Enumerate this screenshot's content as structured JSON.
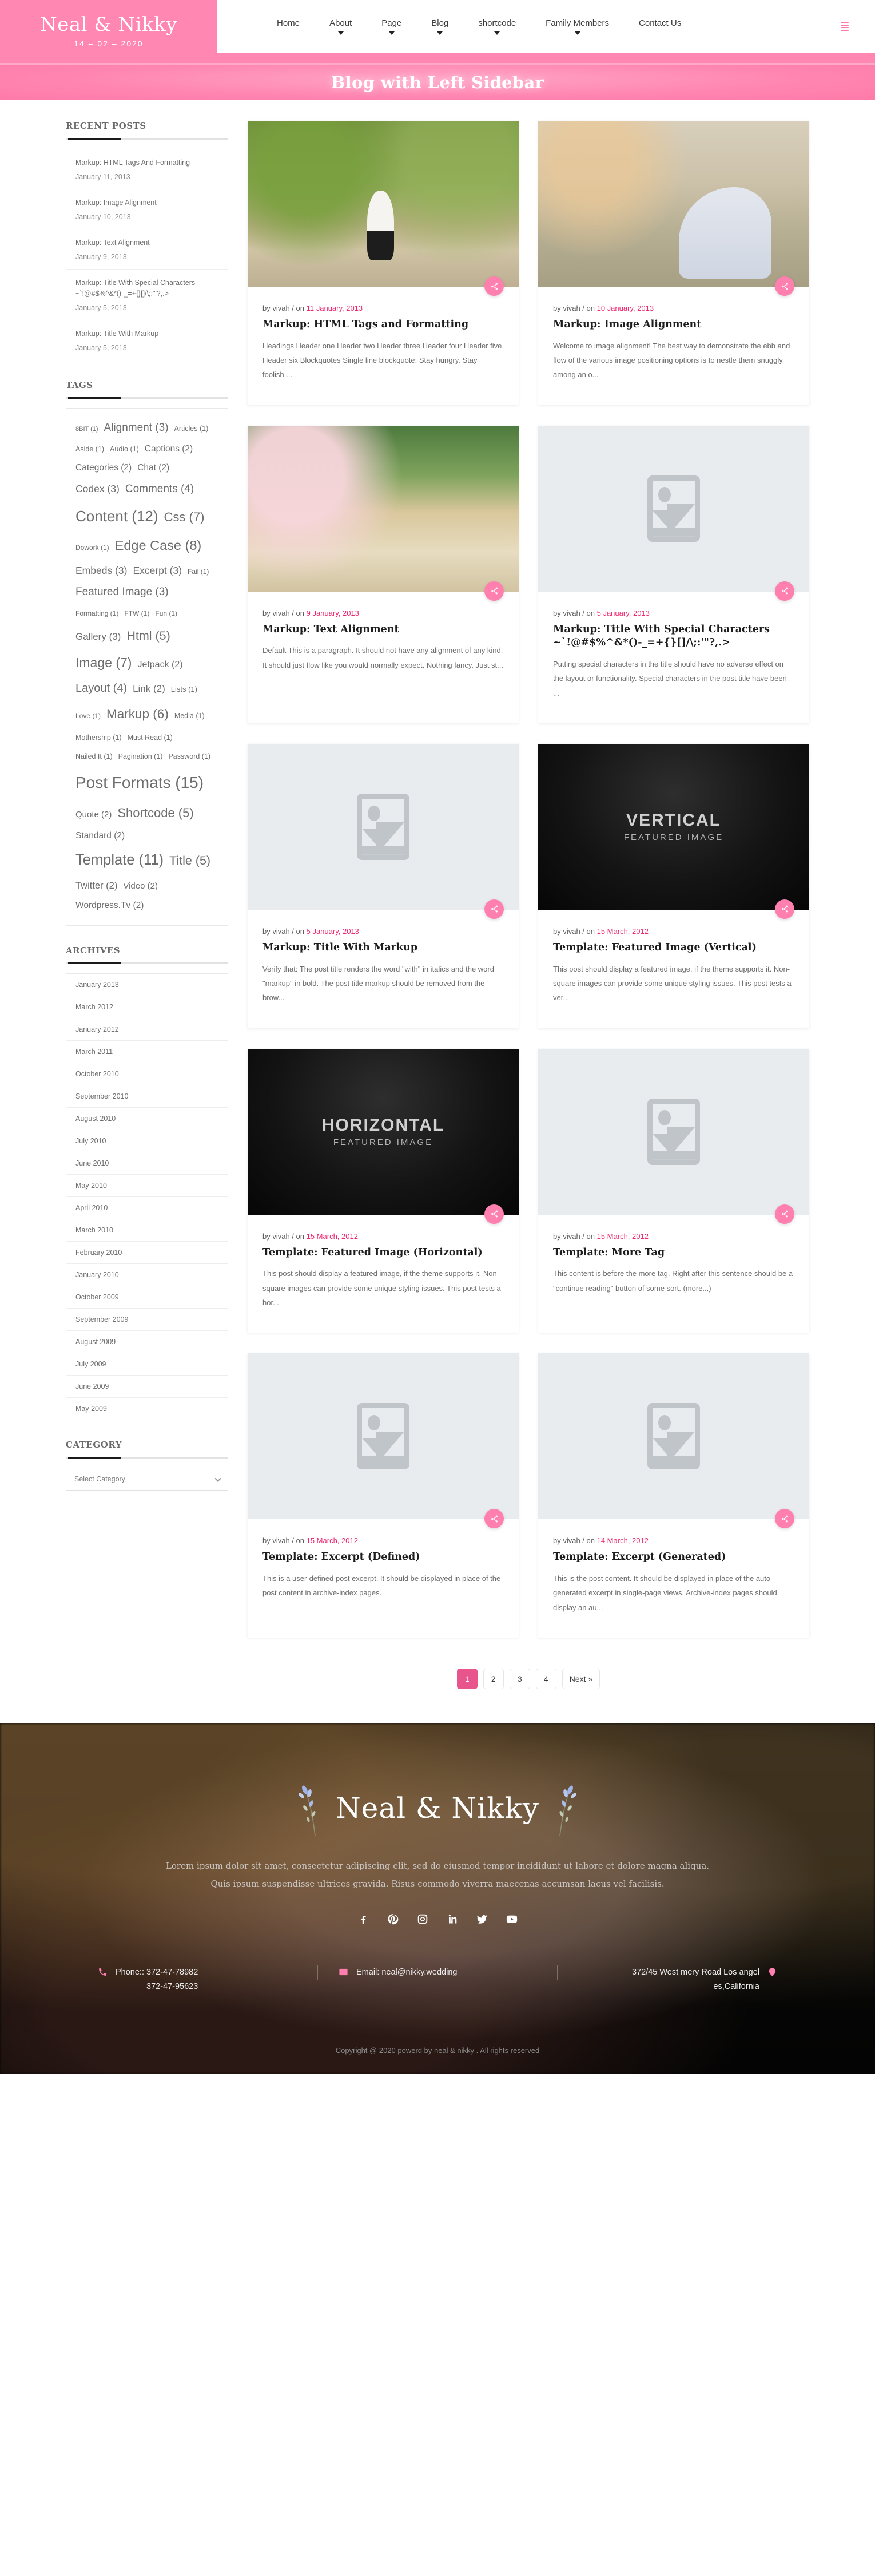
{
  "header": {
    "brand_name": "Neal & Nikky",
    "brand_date": "14 – 02 – 2020",
    "nav": [
      {
        "label": "Home",
        "has_dropdown": false
      },
      {
        "label": "About",
        "has_dropdown": true
      },
      {
        "label": "Page",
        "has_dropdown": true
      },
      {
        "label": "Blog",
        "has_dropdown": true
      },
      {
        "label": "shortcode",
        "has_dropdown": true
      },
      {
        "label": "Family Members",
        "has_dropdown": true
      },
      {
        "label": "Contact Us",
        "has_dropdown": false
      }
    ],
    "menu_icon": "hamburger-icon"
  },
  "banner": {
    "title": "Blog with Left Sidebar"
  },
  "sidebar": {
    "recent_posts": {
      "title": "RECENT POSTS",
      "items": [
        {
          "title": "Markup: HTML Tags And Formatting",
          "date": "January 11, 2013"
        },
        {
          "title": "Markup: Image Alignment",
          "date": "January 10, 2013"
        },
        {
          "title": "Markup: Text Alignment",
          "date": "January 9, 2013"
        },
        {
          "title": "Markup: Title With Special Characters ~`!@#$%^&*()-_=+{}[]/\\;:'\"?,.>",
          "date": "January 5, 2013"
        },
        {
          "title": "Markup: Title With Markup",
          "date": "January 5, 2013"
        }
      ]
    },
    "tags": {
      "title": "TAGS",
      "items": [
        {
          "label": "8BIT (1)",
          "size": 11
        },
        {
          "label": "Alignment (3)",
          "size": 19
        },
        {
          "label": "Articles (1)",
          "size": 12.5
        },
        {
          "label": "Aside (1)",
          "size": 12.5
        },
        {
          "label": "Audio (1)",
          "size": 12.5
        },
        {
          "label": "Captions (2)",
          "size": 15.5
        },
        {
          "label": "Categories (2)",
          "size": 15.5
        },
        {
          "label": "Chat (2)",
          "size": 15.5
        },
        {
          "label": "Codex (3)",
          "size": 17.5
        },
        {
          "label": "Comments (4)",
          "size": 19
        },
        {
          "label": "Content (12)",
          "size": 26
        },
        {
          "label": "Css (7)",
          "size": 22
        },
        {
          "label": "Dowork (1)",
          "size": 12
        },
        {
          "label": "Edge Case (8)",
          "size": 23.5
        },
        {
          "label": "Embeds (3)",
          "size": 17.5
        },
        {
          "label": "Excerpt (3)",
          "size": 17.5
        },
        {
          "label": "Fail (1)",
          "size": 12
        },
        {
          "label": "Featured Image (3)",
          "size": 19
        },
        {
          "label": "Formatting (1)",
          "size": 12
        },
        {
          "label": "FTW (1)",
          "size": 12
        },
        {
          "label": "Fun (1)",
          "size": 12
        },
        {
          "label": "Gallery (3)",
          "size": 17
        },
        {
          "label": "Html (5)",
          "size": 21.5
        },
        {
          "label": "Image (7)",
          "size": 23
        },
        {
          "label": "Jetpack (2)",
          "size": 16
        },
        {
          "label": "Layout (4)",
          "size": 20
        },
        {
          "label": "Link (2)",
          "size": 17
        },
        {
          "label": "Lists (1)",
          "size": 13
        },
        {
          "label": "Love (1)",
          "size": 12
        },
        {
          "label": "Markup (6)",
          "size": 22.5
        },
        {
          "label": "Media (1)",
          "size": 12.5
        },
        {
          "label": "Mothership (1)",
          "size": 12.5
        },
        {
          "label": "Must Read (1)",
          "size": 12.5
        },
        {
          "label": "Nailed It (1)",
          "size": 12.5
        },
        {
          "label": "Pagination (1)",
          "size": 12.5
        },
        {
          "label": "Password (1)",
          "size": 12.5
        },
        {
          "label": "Post Formats (15)",
          "size": 28
        },
        {
          "label": "Quote (2)",
          "size": 15
        },
        {
          "label": "Shortcode (5)",
          "size": 22
        },
        {
          "label": "Standard (2)",
          "size": 15.5
        },
        {
          "label": "Template (11)",
          "size": 25.5
        },
        {
          "label": "Title (5)",
          "size": 21.5
        },
        {
          "label": "Twitter (2)",
          "size": 16.5
        },
        {
          "label": "Video (2)",
          "size": 15
        },
        {
          "label": "Wordpress.Tv (2)",
          "size": 15.5
        }
      ]
    },
    "archives": {
      "title": "ARCHIVES",
      "items": [
        "January 2013",
        "March 2012",
        "January 2012",
        "March 2011",
        "October 2010",
        "September 2010",
        "August 2010",
        "July 2010",
        "June 2010",
        "May 2010",
        "April 2010",
        "March 2010",
        "February 2010",
        "January 2010",
        "October 2009",
        "September 2009",
        "August 2009",
        "July 2009",
        "June 2009",
        "May 2009"
      ]
    },
    "category": {
      "title": "CATEGORY",
      "selected": "Select Category",
      "options": [
        "Select Category"
      ]
    }
  },
  "posts": [
    {
      "author": "by vivah / on ",
      "date": "11 January, 2013",
      "title": "Markup: HTML Tags and Formatting",
      "excerpt": "Headings Header one Header two Header three Header four Header five Header six Blockquotes Single line blockquote: Stay hungry. Stay foolish....",
      "thumb_kind": "photo-forest",
      "thumb_caption_main": "",
      "thumb_caption_sub": "",
      "share_icon": "share-icon"
    },
    {
      "author": "by vivah / on ",
      "date": "10 January, 2013",
      "title": "Markup: Image Alignment",
      "excerpt": "Welcome to image alignment! The best way to demonstrate the ebb and flow of the various image positioning options is to nestle them snuggly among an o...",
      "thumb_kind": "photo-table",
      "thumb_caption_main": "",
      "thumb_caption_sub": "",
      "share_icon": "share-icon"
    },
    {
      "author": "by vivah / on ",
      "date": "9 January, 2013",
      "title": "Markup: Text Alignment",
      "excerpt": "Default This is a paragraph. It should not have any alignment of any kind. It should just flow like you would normally expect. Nothing fancy. Just st...",
      "thumb_kind": "photo-aisle",
      "thumb_caption_main": "",
      "thumb_caption_sub": "",
      "share_icon": "share-icon"
    },
    {
      "author": "by vivah / on ",
      "date": "5 January, 2013",
      "title": "Markup: Title With Special Characters ~`!@#$%^&*()-_=+{}[]/\\;:'\"?,.>",
      "excerpt": "Putting special characters in the title should have no adverse effect on the layout or functionality. Special characters in the post title have been ...",
      "thumb_kind": "placeholder",
      "thumb_caption_main": "",
      "thumb_caption_sub": "",
      "share_icon": "share-icon"
    },
    {
      "author": "by vivah / on ",
      "date": "5 January, 2013",
      "title": "Markup: Title With Markup",
      "excerpt": "Verify that: The post title renders the word \"with\" in italics and the word \"markup\" in bold. The post title markup should be removed from the brow...",
      "thumb_kind": "placeholder",
      "thumb_caption_main": "",
      "thumb_caption_sub": "",
      "share_icon": "share-icon"
    },
    {
      "author": "by vivah / on ",
      "date": "15 March, 2012",
      "title": "Template: Featured Image (Vertical)",
      "excerpt": "This post should display a featured image, if the theme supports it. Non-square images can provide some unique styling issues. This post tests a ver...",
      "thumb_kind": "dark",
      "thumb_caption_main": "VERTICAL",
      "thumb_caption_sub": "FEATURED IMAGE",
      "share_icon": "share-icon"
    },
    {
      "author": "by vivah / on ",
      "date": "15 March, 2012",
      "title": "Template: Featured Image (Horizontal)",
      "excerpt": "This post should display a featured image, if the theme supports it. Non-square images can provide some unique styling issues. This post tests a hor...",
      "thumb_kind": "dark",
      "thumb_caption_main": "HORIZONTAL",
      "thumb_caption_sub": "FEATURED IMAGE",
      "share_icon": "share-icon"
    },
    {
      "author": "by vivah / on ",
      "date": "15 March, 2012",
      "title": "Template: More Tag",
      "excerpt": "This content is before the more tag. Right after this sentence should be a \"continue reading\" button of some sort. (more...)",
      "thumb_kind": "placeholder",
      "thumb_caption_main": "",
      "thumb_caption_sub": "",
      "share_icon": "share-icon"
    },
    {
      "author": "by vivah / on ",
      "date": "15 March, 2012",
      "title": "Template: Excerpt (Defined)",
      "excerpt": "This is a user-defined post excerpt. It should be displayed in place of the post content in archive-index pages.",
      "thumb_kind": "placeholder",
      "thumb_caption_main": "",
      "thumb_caption_sub": "",
      "share_icon": "share-icon"
    },
    {
      "author": "by vivah / on ",
      "date": "14 March, 2012",
      "title": "Template: Excerpt (Generated)",
      "excerpt": "This is the post content. It should be displayed in place of the auto-generated excerpt in single-page views. Archive-index pages should display an au...",
      "thumb_kind": "placeholder",
      "thumb_caption_main": "",
      "thumb_caption_sub": "",
      "share_icon": "share-icon"
    }
  ],
  "pagination": {
    "pages": [
      "1",
      "2",
      "3",
      "4"
    ],
    "active": "1",
    "next_label": "Next »"
  },
  "footer": {
    "brand": "Neal & Nikky",
    "tagline_line1": "Lorem ipsum dolor sit amet, consectetur adipiscing elit, sed do eiusmod tempor incididunt ut labore et dolore magna aliqua.",
    "tagline_line2": "Quis ipsum suspendisse ultrices gravida. Risus commodo viverra maecenas accumsan lacus vel facilisis.",
    "socials": [
      {
        "name": "facebook-icon"
      },
      {
        "name": "pinterest-icon"
      },
      {
        "name": "instagram-icon"
      },
      {
        "name": "linkedin-icon"
      },
      {
        "name": "twitter-icon"
      },
      {
        "name": "youtube-icon"
      }
    ],
    "contact": {
      "phone_label": "Phone::  372-47-78982",
      "phone_second": "372-47-95623",
      "email_label": "Email:  neal@nikky.wedding",
      "address_line1": "372/45 West mery Road Los angel",
      "address_line2": "es,California",
      "phone_icon": "phone-icon",
      "email_icon": "envelope-icon",
      "location_icon": "map-pin-icon"
    },
    "copyright": "Copyright @ 2020 powerd by neal & nikky . All rights reserved"
  },
  "colors": {
    "brand_pink": "#ff87b2",
    "accent_pink": "#ff7fae",
    "date_pink": "#f0276e",
    "pagination_active": "#e8548c"
  }
}
